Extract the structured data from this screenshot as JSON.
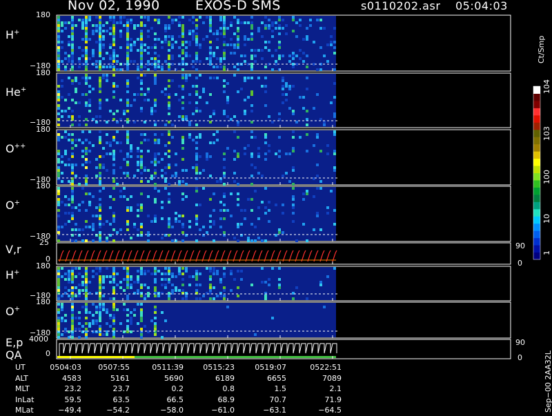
{
  "header": {
    "date": "Nov 02, 1990",
    "instrument": "EXOS-D SMS",
    "file": "s0110202.asr",
    "time": "05:04:03"
  },
  "colorbar": {
    "unit_label": "Ct/Smp",
    "tick_labels": [
      "1",
      "10",
      "100",
      "10",
      "10"
    ],
    "tick_exponents": [
      "",
      "",
      "",
      "3",
      "4"
    ],
    "colors": [
      "#000080",
      "#0010a8",
      "#0030d0",
      "#0060f0",
      "#0090ff",
      "#00c8ff",
      "#20e0c0",
      "#00a080",
      "#008040",
      "#00a030",
      "#30c020",
      "#80e020",
      "#c0e000",
      "#ffff00",
      "#e0c000",
      "#a08000",
      "#807000",
      "#606000",
      "#a02000",
      "#e01000",
      "#ff3030",
      "#800000",
      "#600000",
      "#ffffff"
    ]
  },
  "panels": [
    {
      "id": "H+1",
      "label": "H",
      "charge": "+",
      "ymax": "180",
      "ymin": "−180"
    },
    {
      "id": "He+",
      "label": "He",
      "charge": "+",
      "ymax": "180",
      "ymin": "−180"
    },
    {
      "id": "O++",
      "label": "O",
      "charge": "++",
      "ymax": "180",
      "ymin": "−180"
    },
    {
      "id": "O+1",
      "label": "O",
      "charge": "+",
      "ymax": "180",
      "ymin": "−180"
    },
    {
      "id": "Vr",
      "label": "V,r",
      "charge": "",
      "ymax": "25",
      "ymin": "0",
      "rmax": "90",
      "rmin": "0"
    },
    {
      "id": "H+2",
      "label": "H",
      "charge": "+",
      "ymax": "180",
      "ymin": "−180"
    },
    {
      "id": "O+2",
      "label": "O",
      "charge": "+",
      "ymax": "180",
      "ymin": "−180"
    },
    {
      "id": "Ep",
      "label": "E,p",
      "label2": "QA",
      "charge": "",
      "ymax": "4000",
      "ymin": "0",
      "rmax": "90",
      "rmin": "0"
    }
  ],
  "ephemeris": {
    "rows": [
      {
        "name": "UT",
        "values": [
          "0504:03",
          "0507:55",
          "0511:39",
          "0515:23",
          "0519:07",
          "0522:51"
        ]
      },
      {
        "name": "ALT",
        "values": [
          "4583",
          "5161",
          "5690",
          "6189",
          "6655",
          "7089"
        ]
      },
      {
        "name": "MLT",
        "values": [
          "23.2",
          "23.7",
          "0.2",
          "0.8",
          "1.5",
          "2.1"
        ]
      },
      {
        "name": "InLat",
        "values": [
          "59.5",
          "63.5",
          "66.5",
          "68.9",
          "70.7",
          "71.9"
        ]
      },
      {
        "name": "MLat",
        "values": [
          "−49.4",
          "−54.2",
          "−58.0",
          "−61.0",
          "−63.1",
          "−64.5"
        ]
      }
    ]
  },
  "footer": {
    "label": "Sep−00  2AA32L"
  },
  "chart_data": {
    "type": "heatmap",
    "title": "Nov 02, 1990   EXOS-D SMS",
    "x_ticks": [
      "0504:03",
      "0507:55",
      "0511:39",
      "0515:23",
      "0519:07",
      "0522:51"
    ],
    "y_range_pitch": [
      -180,
      180
    ],
    "series": [
      {
        "name": "H+"
      },
      {
        "name": "He+"
      },
      {
        "name": "O++"
      },
      {
        "name": "O+"
      },
      {
        "name": "V,r"
      },
      {
        "name": "H+"
      },
      {
        "name": "O+"
      },
      {
        "name": "E,p"
      }
    ],
    "color_scale": "log",
    "color_range": [
      1,
      10000
    ]
  }
}
